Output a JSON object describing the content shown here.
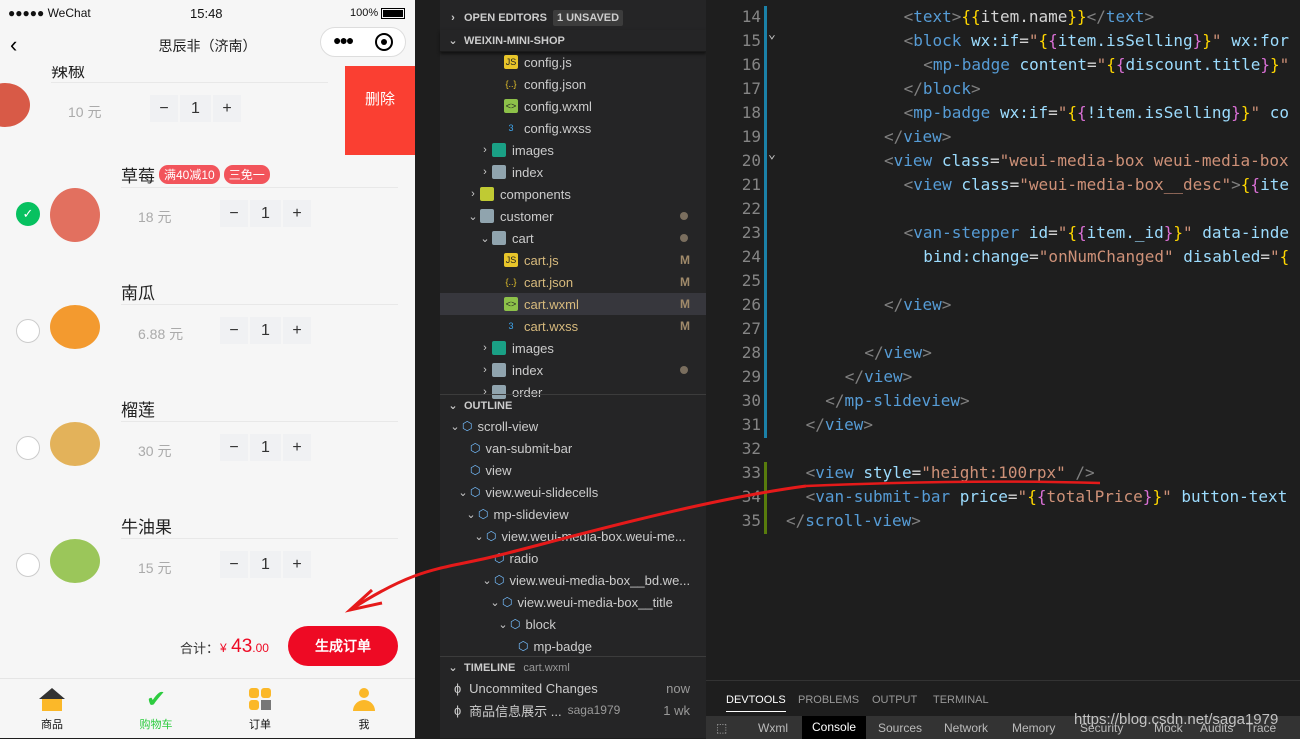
{
  "phone": {
    "status": {
      "carrier": "●●●●● WeChat",
      "time": "15:48",
      "battery": "100%"
    },
    "title": "思辰非（济南）",
    "delete_label": "删除",
    "items": [
      {
        "name": "辣椒",
        "price": "10 元",
        "qty": "1",
        "checked": false,
        "color": "#d85a47"
      },
      {
        "name": "草莓",
        "price": "18 元",
        "qty": "1",
        "checked": true,
        "badges": [
          "满40减10",
          "三免一"
        ],
        "color": "#e2705f"
      },
      {
        "name": "南瓜",
        "price": "6.88 元",
        "qty": "1",
        "checked": false,
        "color": "#f39a2f"
      },
      {
        "name": "榴莲",
        "price": "30 元",
        "qty": "1",
        "checked": false,
        "color": "#e3b25a"
      },
      {
        "name": "牛油果",
        "price": "15 元",
        "qty": "1",
        "checked": false,
        "color": "#9bc65a"
      }
    ],
    "total_label": "合计：",
    "currency": "¥",
    "total_int": "43",
    "total_dec": ".00",
    "submit_label": "生成订单",
    "tabs": [
      {
        "label": "商品",
        "active": false
      },
      {
        "label": "购物车",
        "active": true
      },
      {
        "label": "订单",
        "active": false
      },
      {
        "label": "我",
        "active": false
      }
    ]
  },
  "explorer": {
    "open_editors": "OPEN EDITORS",
    "unsaved": "1 UNSAVED",
    "project": "WEIXIN-MINI-SHOP",
    "files": [
      {
        "name": "config.js",
        "type": "js",
        "indent": 3
      },
      {
        "name": "config.json",
        "type": "json",
        "indent": 3
      },
      {
        "name": "config.wxml",
        "type": "wxml",
        "indent": 3
      },
      {
        "name": "config.wxss",
        "type": "wxss",
        "indent": 3
      },
      {
        "name": "images",
        "type": "imgfolder",
        "indent": 2,
        "chev": ">"
      },
      {
        "name": "index",
        "type": "folder",
        "indent": 2,
        "chev": ">"
      },
      {
        "name": "components",
        "type": "compfolder",
        "indent": 1,
        "chev": ">"
      },
      {
        "name": "customer",
        "type": "openfolder",
        "indent": 1,
        "chev": "v",
        "dot": true
      },
      {
        "name": "cart",
        "type": "openfolder",
        "indent": 2,
        "chev": "v",
        "dot": true
      },
      {
        "name": "cart.js",
        "type": "js",
        "indent": 3,
        "mark": "M"
      },
      {
        "name": "cart.json",
        "type": "json",
        "indent": 3,
        "mark": "M"
      },
      {
        "name": "cart.wxml",
        "type": "wxml",
        "indent": 3,
        "mark": "M",
        "selected": true
      },
      {
        "name": "cart.wxss",
        "type": "wxss",
        "indent": 3,
        "mark": "M"
      },
      {
        "name": "images",
        "type": "imgfolder",
        "indent": 2,
        "chev": ">"
      },
      {
        "name": "index",
        "type": "folder",
        "indent": 2,
        "chev": ">",
        "dot": true
      },
      {
        "name": "order",
        "type": "folder",
        "indent": 2,
        "chev": ">"
      }
    ],
    "outline_title": "OUTLINE",
    "outline": [
      {
        "name": "scroll-view",
        "indent": 1,
        "chev": "v"
      },
      {
        "name": "van-submit-bar",
        "indent": 2
      },
      {
        "name": "view",
        "indent": 2
      },
      {
        "name": "view.weui-slidecells",
        "indent": 2,
        "chev": "v"
      },
      {
        "name": "mp-slideview",
        "indent": 3,
        "chev": "v"
      },
      {
        "name": "view.weui-media-box.weui-me...",
        "indent": 4,
        "chev": "v"
      },
      {
        "name": "radio",
        "indent": 5
      },
      {
        "name": "view.weui-media-box__bd.we...",
        "indent": 5,
        "chev": "v"
      },
      {
        "name": "view.weui-media-box__title",
        "indent": 6,
        "chev": "v"
      },
      {
        "name": "block",
        "indent": 7,
        "chev": "v"
      },
      {
        "name": "mp-badge",
        "indent": 8
      }
    ],
    "timeline_title": "TIMELINE",
    "timeline_file": "cart.wxml",
    "timeline": [
      {
        "label": "Uncommited Changes",
        "author": "",
        "when": "now"
      },
      {
        "label": "商品信息展示 ...",
        "author": "saga1979",
        "when": "1 wk"
      }
    ]
  },
  "editor": {
    "lines": [
      {
        "n": "14",
        "i": 6,
        "s": [
          [
            "b",
            "<"
          ],
          [
            "n",
            "text"
          ],
          [
            "b",
            ">"
          ],
          [
            "y",
            "{{"
          ],
          [
            "x",
            "item.name"
          ],
          [
            "y",
            "}}"
          ],
          [
            "b",
            "</"
          ],
          [
            "n",
            "text"
          ],
          [
            "b",
            ">"
          ]
        ]
      },
      {
        "n": "15",
        "i": 6,
        "f": true,
        "s": [
          [
            "b",
            "<"
          ],
          [
            "n",
            "block"
          ],
          [
            "x",
            " "
          ],
          [
            "a",
            "wx:if"
          ],
          [
            "x",
            "="
          ],
          [
            "s",
            "\""
          ],
          [
            "y",
            "{"
          ],
          [
            "p",
            "{"
          ],
          [
            "a",
            "item.isSelling"
          ],
          [
            "p",
            "}"
          ],
          [
            "y",
            "}"
          ],
          [
            "s",
            "\""
          ],
          [
            "x",
            " "
          ],
          [
            "a",
            "wx:for"
          ]
        ]
      },
      {
        "n": "16",
        "i": 7,
        "s": [
          [
            "b",
            "<"
          ],
          [
            "n",
            "mp-badge"
          ],
          [
            "x",
            " "
          ],
          [
            "a",
            "content"
          ],
          [
            "x",
            "="
          ],
          [
            "s",
            "\""
          ],
          [
            "y",
            "{"
          ],
          [
            "p",
            "{"
          ],
          [
            "a",
            "discount.title"
          ],
          [
            "p",
            "}"
          ],
          [
            "y",
            "}"
          ],
          [
            "s",
            "\""
          ]
        ]
      },
      {
        "n": "17",
        "i": 6,
        "s": [
          [
            "b",
            "</"
          ],
          [
            "n",
            "block"
          ],
          [
            "b",
            ">"
          ]
        ]
      },
      {
        "n": "18",
        "i": 6,
        "s": [
          [
            "b",
            "<"
          ],
          [
            "n",
            "mp-badge"
          ],
          [
            "x",
            " "
          ],
          [
            "a",
            "wx:if"
          ],
          [
            "x",
            "="
          ],
          [
            "s",
            "\""
          ],
          [
            "y",
            "{"
          ],
          [
            "p",
            "{"
          ],
          [
            "a",
            "!item.isSelling"
          ],
          [
            "p",
            "}"
          ],
          [
            "y",
            "}"
          ],
          [
            "s",
            "\""
          ],
          [
            "x",
            " "
          ],
          [
            "a",
            "co"
          ]
        ]
      },
      {
        "n": "19",
        "i": 5,
        "s": [
          [
            "b",
            "</"
          ],
          [
            "n",
            "view"
          ],
          [
            "b",
            ">"
          ]
        ]
      },
      {
        "n": "20",
        "i": 5,
        "f": true,
        "s": [
          [
            "b",
            "<"
          ],
          [
            "n",
            "view"
          ],
          [
            "x",
            " "
          ],
          [
            "a",
            "class"
          ],
          [
            "x",
            "="
          ],
          [
            "s",
            "\"weui-media-box weui-media-box"
          ]
        ]
      },
      {
        "n": "21",
        "i": 6,
        "s": [
          [
            "b",
            "<"
          ],
          [
            "n",
            "view"
          ],
          [
            "x",
            " "
          ],
          [
            "a",
            "class"
          ],
          [
            "x",
            "="
          ],
          [
            "s",
            "\"weui-media-box__desc\""
          ],
          [
            "b",
            ">"
          ],
          [
            "y",
            "{"
          ],
          [
            "p",
            "{"
          ],
          [
            "a",
            "ite"
          ]
        ]
      },
      {
        "n": "22",
        "i": 0,
        "s": []
      },
      {
        "n": "23",
        "i": 6,
        "s": [
          [
            "b",
            "<"
          ],
          [
            "n",
            "van-stepper"
          ],
          [
            "x",
            " "
          ],
          [
            "a",
            "id"
          ],
          [
            "x",
            "="
          ],
          [
            "s",
            "\""
          ],
          [
            "y",
            "{"
          ],
          [
            "p",
            "{"
          ],
          [
            "a",
            "item._id"
          ],
          [
            "p",
            "}"
          ],
          [
            "y",
            "}"
          ],
          [
            "s",
            "\""
          ],
          [
            "x",
            " "
          ],
          [
            "a",
            "data-inde"
          ]
        ]
      },
      {
        "n": "24",
        "i": 7,
        "s": [
          [
            "a",
            "bind:change"
          ],
          [
            "x",
            "="
          ],
          [
            "s",
            "\"onNumChanged\""
          ],
          [
            "x",
            " "
          ],
          [
            "a",
            "disabled"
          ],
          [
            "x",
            "="
          ],
          [
            "s",
            "\""
          ],
          [
            "y",
            "{"
          ]
        ]
      },
      {
        "n": "25",
        "i": 0,
        "s": []
      },
      {
        "n": "26",
        "i": 5,
        "s": [
          [
            "b",
            "</"
          ],
          [
            "n",
            "view"
          ],
          [
            "b",
            ">"
          ]
        ]
      },
      {
        "n": "27",
        "i": 0,
        "s": []
      },
      {
        "n": "28",
        "i": 4,
        "s": [
          [
            "b",
            "</"
          ],
          [
            "n",
            "view"
          ],
          [
            "b",
            ">"
          ]
        ]
      },
      {
        "n": "29",
        "i": 3,
        "s": [
          [
            "b",
            "</"
          ],
          [
            "n",
            "view"
          ],
          [
            "b",
            ">"
          ]
        ]
      },
      {
        "n": "30",
        "i": 2,
        "s": [
          [
            "b",
            "</"
          ],
          [
            "n",
            "mp-slideview"
          ],
          [
            "b",
            ">"
          ]
        ]
      },
      {
        "n": "31",
        "i": 1,
        "s": [
          [
            "b",
            "</"
          ],
          [
            "n",
            "view"
          ],
          [
            "b",
            ">"
          ]
        ]
      },
      {
        "n": "32",
        "i": 0,
        "s": []
      },
      {
        "n": "33",
        "i": 1,
        "s": [
          [
            "b",
            "<"
          ],
          [
            "n",
            "view"
          ],
          [
            "x",
            " "
          ],
          [
            "a",
            "style"
          ],
          [
            "x",
            "="
          ],
          [
            "s",
            "\"height:100rpx\""
          ],
          [
            "x",
            " "
          ],
          [
            "b",
            "/>"
          ]
        ]
      },
      {
        "n": "34",
        "i": 1,
        "s": [
          [
            "b",
            "<"
          ],
          [
            "n",
            "van-submit-bar"
          ],
          [
            "x",
            " "
          ],
          [
            "a",
            "price"
          ],
          [
            "x",
            "="
          ],
          [
            "s",
            "\""
          ],
          [
            "y",
            "{"
          ],
          [
            "p",
            "{"
          ],
          [
            "s",
            "totalPrice"
          ],
          [
            "p",
            "}"
          ],
          [
            "y",
            "}"
          ],
          [
            "s",
            "\""
          ],
          [
            "x",
            " "
          ],
          [
            "a",
            "button-text"
          ]
        ]
      },
      {
        "n": "35",
        "i": 0,
        "s": [
          [
            "b",
            "</"
          ],
          [
            "n",
            "scroll-view"
          ],
          [
            "b",
            ">"
          ]
        ]
      }
    ]
  },
  "panel": {
    "tabs": [
      "DEVTOOLS",
      "PROBLEMS",
      "OUTPUT",
      "TERMINAL"
    ],
    "devtools_tabs": [
      "Wxml",
      "Console",
      "Sources",
      "Network",
      "Memory",
      "Security",
      "Mock",
      "Audits",
      "Trace"
    ],
    "active_devtools": "Console",
    "watermark": "https://blog.csdn.net/saga1979"
  },
  "colors": {
    "accent_red": "#ee0a24",
    "delete_red": "#fa3f32",
    "check_green": "#07c160",
    "tab_green": "#2ecc40",
    "code_bg": "#1e1e1e",
    "sidebar_bg": "#252526"
  }
}
